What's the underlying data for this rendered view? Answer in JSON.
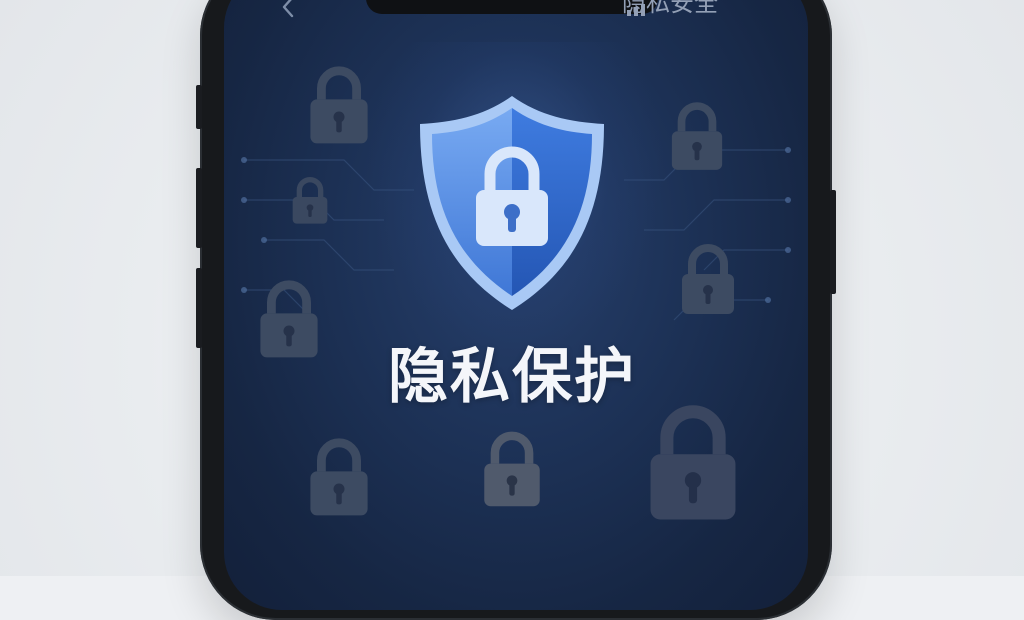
{
  "topbar": {
    "back_icon": "chevron-left-icon",
    "title": "隐私安全"
  },
  "hero": {
    "icon": "shield-lock-icon",
    "title": "隐私保护"
  },
  "decorations": {
    "background_icon": "padlock-icon"
  },
  "colors": {
    "screen_bg": "#1d3257",
    "shield_light": "#6ea2ee",
    "shield_dark": "#2f66c8",
    "title_text": "#f4f6fa"
  }
}
